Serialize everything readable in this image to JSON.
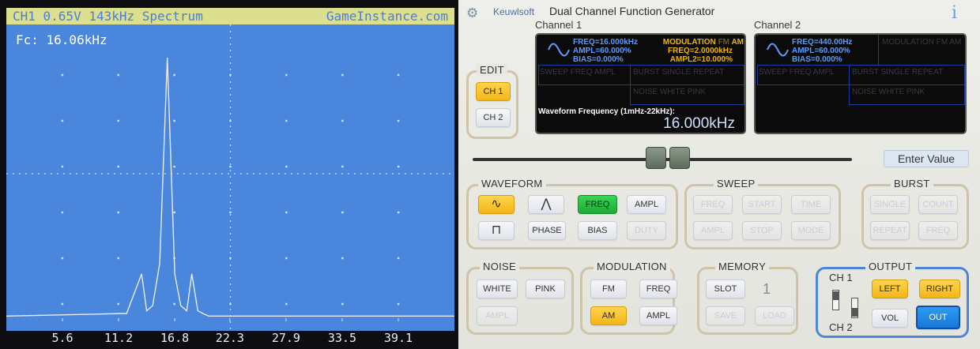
{
  "scope": {
    "title_left": "CH1 0.65V 143kHz Spectrum",
    "title_right": "GameInstance.com",
    "fc_label": "Fc: 16.06kHz",
    "x_ticks": [
      "5.6",
      "11.2",
      "16.8",
      "22.3",
      "27.9",
      "33.5",
      "39.1"
    ],
    "colors": {
      "screen": "#4b86dd",
      "trace": "#e8ecf4",
      "title_bar": "#dcdf8e"
    }
  },
  "chart_data": {
    "type": "line",
    "title": "CH1 0.65V 143kHz Spectrum",
    "xlabel": "",
    "ylabel": "",
    "x_ticks": [
      5.6,
      11.2,
      16.8,
      22.3,
      27.9,
      33.5,
      39.1
    ],
    "xlim": [
      0,
      44.7
    ],
    "ylim": [
      0,
      1
    ],
    "annotation": "Fc: 16.06kHz",
    "series": [
      {
        "x": [
          0,
          12,
          13.5,
          14.0,
          14.6,
          15.3,
          16.06,
          16.8,
          17.4,
          18.0,
          18.5,
          19.1,
          19.6,
          20.2,
          21,
          44.7
        ],
        "y": [
          0.02,
          0.03,
          0.18,
          0.04,
          0.06,
          0.22,
          1.0,
          0.18,
          0.06,
          0.04,
          0.18,
          0.04,
          0.03,
          0.02,
          0.02,
          0.02
        ]
      }
    ]
  },
  "app": {
    "brand": "Keuwlsoft",
    "title": "Dual Channel Function Generator",
    "info": "i",
    "ch1_label": "Channel 1",
    "ch2_label": "Channel 2",
    "ch1": {
      "freq": "FREQ=16.000kHz",
      "ampl": "AMPL=60.000%",
      "bias": "BIAS=0.000%",
      "mod_title": "MODULATION",
      "mod_fm": "FM",
      "mod_am": "AM",
      "mod_freq": "FREQ=2.0000kHz",
      "mod_ampl2": "AMPL2=10.000%",
      "sweep_row": "SWEEP FREQ AMPL",
      "burst_row": "BURST SINGLE REPEAT",
      "noise_row": "NOISE WHITE PINK",
      "wf_label": "Waveform Frequency (1mHz-22kHz):",
      "wf_value": "16.000kHz"
    },
    "ch2": {
      "freq": "FREQ=440.00Hz",
      "ampl": "AMPL=60.000%",
      "bias": "BIAS=0.000%",
      "mod_line": "MODULATION FM AM",
      "sweep_row": "SWEEP FREQ AMPL",
      "burst_row": "BURST SINGLE REPEAT",
      "noise_row": "NOISE WHITE PINK"
    },
    "enter_value": "Enter Value",
    "edit": {
      "label": "EDIT",
      "ch1": "CH 1",
      "ch2": "CH 2"
    },
    "waveform": {
      "label": "WAVEFORM",
      "sine": "∿",
      "triangle": "⋀",
      "square": "⊓",
      "freq": "FREQ",
      "ampl": "AMPL",
      "phase": "PHASE",
      "bias": "BIAS",
      "duty": "DUTY"
    },
    "sweep": {
      "label": "SWEEP",
      "freq": "FREQ",
      "start": "START",
      "time": "TIME",
      "ampl": "AMPL",
      "stop": "STOP",
      "mode": "MODE"
    },
    "burst": {
      "label": "BURST",
      "single": "SINGLE",
      "count": "COUNT",
      "repeat": "REPEAT",
      "freq": "FREQ"
    },
    "noise": {
      "label": "NOISE",
      "white": "WHITE",
      "pink": "PINK",
      "ampl": "AMPL"
    },
    "modulation": {
      "label": "MODULATION",
      "fm": "FM",
      "freq": "FREQ",
      "am": "AM",
      "ampl": "AMPL"
    },
    "memory": {
      "label": "MEMORY",
      "slot": "SLOT",
      "slot_value": "1",
      "save": "SAVE",
      "load": "LOAD"
    },
    "output": {
      "label": "OUTPUT",
      "ch1": "CH 1",
      "ch2": "CH 2",
      "left": "LEFT",
      "right": "RIGHT",
      "vol": "VOL",
      "out": "OUT"
    },
    "colors": {
      "accent_gold": "#f3b616",
      "accent_green": "#1eaa36",
      "accent_blue": "#1a76d8",
      "lcd_text": "#5a9cff",
      "lcd_mod": "#f0b400"
    }
  }
}
